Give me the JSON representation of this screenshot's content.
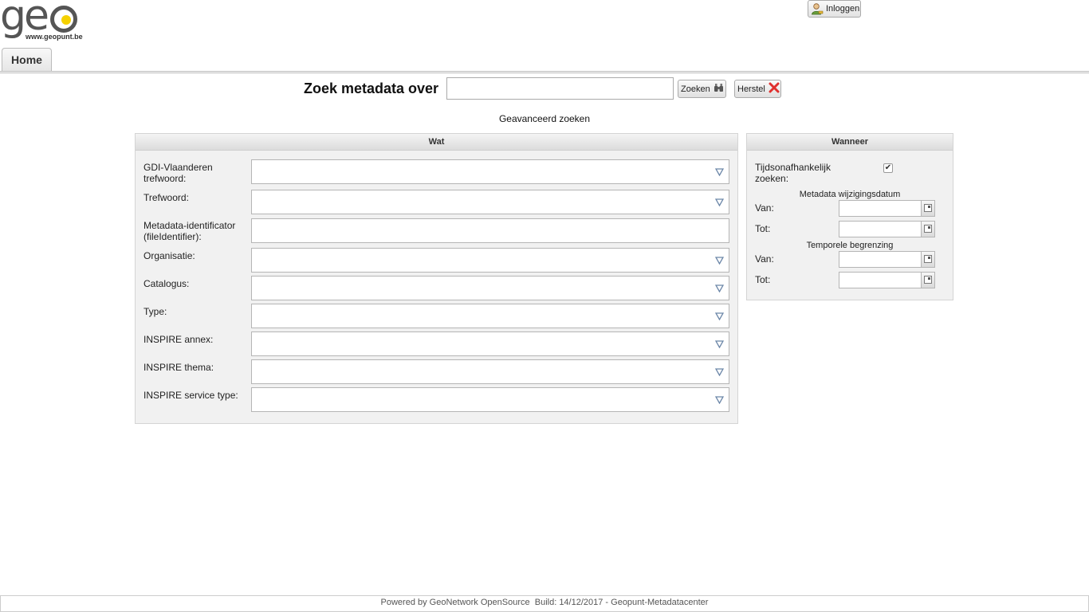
{
  "logo": {
    "word": "ge",
    "url_text": "www.geopunt.be"
  },
  "header": {
    "login_label": "Inloggen"
  },
  "tabs": [
    {
      "label": "Home"
    }
  ],
  "search": {
    "title": "Zoek metadata over",
    "query_value": "",
    "search_button": "Zoeken",
    "reset_button": "Herstel",
    "advanced_link": "Geavanceerd zoeken"
  },
  "wat": {
    "title": "Wat",
    "fields": [
      {
        "label": "GDI-Vlaanderen trefwoord:",
        "kind": "combo",
        "value": ""
      },
      {
        "label": "Trefwoord:",
        "kind": "combo",
        "value": ""
      },
      {
        "label": "Metadata-identificator (fileIdentifier):",
        "kind": "text",
        "value": ""
      },
      {
        "label": "Organisatie:",
        "kind": "combo",
        "value": ""
      },
      {
        "label": "Catalogus:",
        "kind": "combo",
        "value": ""
      },
      {
        "label": "Type:",
        "kind": "combo",
        "value": ""
      },
      {
        "label": "INSPIRE annex:",
        "kind": "combo",
        "value": ""
      },
      {
        "label": "INSPIRE thema:",
        "kind": "combo",
        "value": ""
      },
      {
        "label": "INSPIRE service type:",
        "kind": "combo",
        "value": ""
      }
    ]
  },
  "wanneer": {
    "title": "Wanneer",
    "time_independent_label": "Tijdsonafhankelijk zoeken:",
    "time_independent_checked": true,
    "metadata_change_heading": "Metadata wijzigingsdatum",
    "temporal_extent_heading": "Temporele begrenzing",
    "from_label": "Van:",
    "to_label": "Tot:",
    "meta_from": "",
    "meta_to": "",
    "temp_from": "",
    "temp_to": ""
  },
  "footer": {
    "text": "Powered by GeoNetwork OpenSource  Build: 14/12/2017 - Geopunt-Metadatacenter"
  },
  "colors": {
    "logo_gray": "#555555",
    "logo_dot": "#f5d100",
    "reset_x": "#e0302e"
  }
}
